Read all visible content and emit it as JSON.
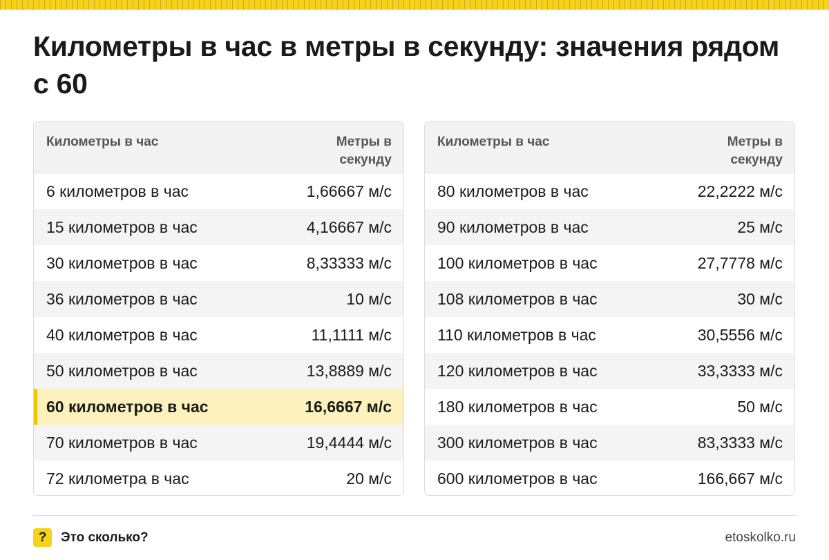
{
  "title": "Километры в час в метры в секунду: значения рядом с 60",
  "tables": [
    {
      "header": {
        "col1": "Километры в час",
        "col2": "Метры в секунду"
      },
      "rows": [
        {
          "kmh": "6 километров в час",
          "ms": "1,66667 м/с"
        },
        {
          "kmh": "15 километров в час",
          "ms": "4,16667 м/с"
        },
        {
          "kmh": "30 километров в час",
          "ms": "8,33333 м/с"
        },
        {
          "kmh": "36 километров в час",
          "ms": "10 м/с"
        },
        {
          "kmh": "40 километров в час",
          "ms": "11,1111 м/с"
        },
        {
          "kmh": "50 километров в час",
          "ms": "13,8889 м/с"
        },
        {
          "kmh": "60 километров в час",
          "ms": "16,6667 м/с",
          "highlight": true
        },
        {
          "kmh": "70 километров в час",
          "ms": "19,4444 м/с"
        },
        {
          "kmh": "72 километра в час",
          "ms": "20 м/с"
        }
      ]
    },
    {
      "header": {
        "col1": "Километры в час",
        "col2": "Метры в секунду"
      },
      "rows": [
        {
          "kmh": "80 километров в час",
          "ms": "22,2222 м/с"
        },
        {
          "kmh": "90 километров в час",
          "ms": "25 м/с"
        },
        {
          "kmh": "100 километров в час",
          "ms": "27,7778 м/с"
        },
        {
          "kmh": "108 километров в час",
          "ms": "30 м/с"
        },
        {
          "kmh": "110 километров в час",
          "ms": "30,5556 м/с"
        },
        {
          "kmh": "120 километров в час",
          "ms": "33,3333 м/с"
        },
        {
          "kmh": "180 километров в час",
          "ms": "50 м/с"
        },
        {
          "kmh": "300 километров в час",
          "ms": "83,3333 м/с"
        },
        {
          "kmh": "600 километров в час",
          "ms": "166,667 м/с"
        }
      ]
    }
  ],
  "footer": {
    "badge": "?",
    "brand": "Это сколько?",
    "site": "etoskolko.ru"
  },
  "colors": {
    "accent": "#f7d21b",
    "highlight_bg": "#fdf1bd",
    "highlight_bar": "#f2c500"
  }
}
